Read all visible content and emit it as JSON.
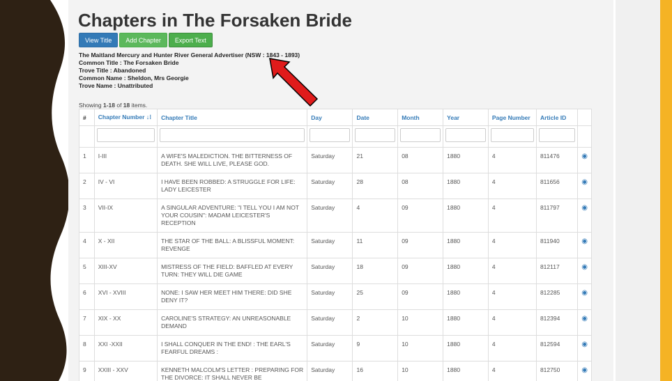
{
  "page": {
    "title": "Chapters in The Forsaken Bride",
    "buttons": {
      "view": "View Title",
      "add": "Add Chapter",
      "export": "Export Text"
    },
    "meta": [
      "The Maitland Mercury and Hunter River General Advertiser (NSW : 1843 - 1893)",
      "Common Title : The Forsaken Bride",
      "Trove Title : Abandoned",
      "Common Name : Sheldon, Mrs Georgie",
      "Trove Name : Unattributed"
    ],
    "summary": {
      "prefix": "Showing ",
      "range": "1-18",
      "middle": " of ",
      "total": "18",
      "suffix": " items."
    }
  },
  "table": {
    "headers": [
      "#",
      "Chapter Number",
      "Chapter Title",
      "Day",
      "Date",
      "Month",
      "Year",
      "Page Number",
      "Article ID"
    ],
    "rows": [
      [
        "1",
        "I-III",
        "A WIFE'S MALEDICTION. THE BITTERNESS OF DEATH. SHE WILL LIVE, PLEASE GOD.",
        "Saturday",
        "21",
        "08",
        "1880",
        "4",
        "811476"
      ],
      [
        "2",
        "IV - VI",
        "I HAVE BEEN ROBBED: A STRUGGLE FOR LIFE: LADY LEICESTER",
        "Saturday",
        "28",
        "08",
        "1880",
        "4",
        "811656"
      ],
      [
        "3",
        "VII-IX",
        "A SINGULAR ADVENTURE: \"I TELL YOU I AM NOT YOUR COUSIN\": MADAM LEICESTER'S RECEPTION",
        "Saturday",
        "4",
        "09",
        "1880",
        "4",
        "811797"
      ],
      [
        "4",
        "X - XII",
        "THE STAR OF THE BALL: A BLISSFUL MOMENT: REVENGE",
        "Saturday",
        "11",
        "09",
        "1880",
        "4",
        "811940"
      ],
      [
        "5",
        "XIII-XV",
        "MISTRESS OF THE FIELD: BAFFLED AT EVERY TURN: THEY WILL DIE GAME",
        "Saturday",
        "18",
        "09",
        "1880",
        "4",
        "812117"
      ],
      [
        "6",
        "XVI - XVIII",
        "NONE: I SAW HER MEET HIM THERE: DID SHE DENY IT?",
        "Saturday",
        "25",
        "09",
        "1880",
        "4",
        "812285"
      ],
      [
        "7",
        "XIX - XX",
        "CAROLINE'S STRATEGY: AN UNREASONABLE DEMAND",
        "Saturday",
        "2",
        "10",
        "1880",
        "4",
        "812394"
      ],
      [
        "8",
        "XXI -XXII",
        "I SHALL CONQUER IN THE END! : THE EARL'S FEARFUL DREAMS :",
        "Saturday",
        "9",
        "10",
        "1880",
        "4",
        "812594"
      ],
      [
        "9",
        "XXIII - XXV",
        "KENNETH MALCOLM'S LETTER : PREPARING FOR THE DIVORCE: IT SHALL NEVER BE",
        "Saturday",
        "16",
        "10",
        "1880",
        "4",
        "812750"
      ]
    ]
  },
  "icons": {
    "sort": "sort-icon",
    "view": "eye-icon",
    "annotation": "red-arrow"
  },
  "colors": {
    "band_dark": "#2e2114",
    "accent_yellow": "#f5b325",
    "link_blue": "#337ab7",
    "button_green": "#5cb85c",
    "arrow_red": "#e01b1b"
  }
}
